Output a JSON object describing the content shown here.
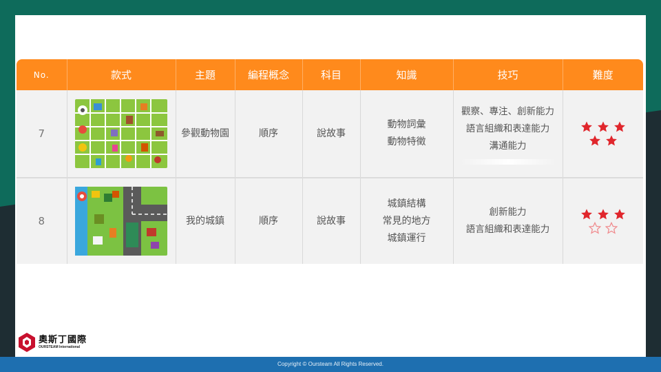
{
  "table": {
    "headers": [
      "No.",
      "款式",
      "主題",
      "編程概念",
      "科目",
      "知識",
      "技巧",
      "難度"
    ],
    "rows": [
      {
        "no": "7",
        "theme": "參觀動物園",
        "concept": "順序",
        "subject": "說故事",
        "knowledge": [
          "動物詞彙",
          "動物特徵"
        ],
        "skills": [
          "觀察、專注、創新能力",
          "語言組織和表達能力",
          "溝通能力"
        ],
        "difficulty": 5,
        "difficulty_max": 5,
        "thumb_icon": "zoo-map-icon"
      },
      {
        "no": "8",
        "theme": "我的城鎮",
        "concept": "順序",
        "subject": "說故事",
        "knowledge": [
          "城鎮結構",
          "常見的地方",
          "城鎮運行"
        ],
        "skills": [
          "創新能力",
          "語言組織和表達能力"
        ],
        "difficulty": 3,
        "difficulty_max": 5,
        "thumb_icon": "town-map-icon"
      }
    ]
  },
  "logo": {
    "name": "奧斯丁國際",
    "subtitle": "OURSTEAM International"
  },
  "footer": {
    "copyright": "Copyright © Oursteam All Rights Reserved."
  },
  "colors": {
    "header_bg": "#ff8a1c",
    "star_filled": "#e0262c",
    "star_empty": "#f08a8d",
    "footer_bg": "#1e6fb0"
  }
}
